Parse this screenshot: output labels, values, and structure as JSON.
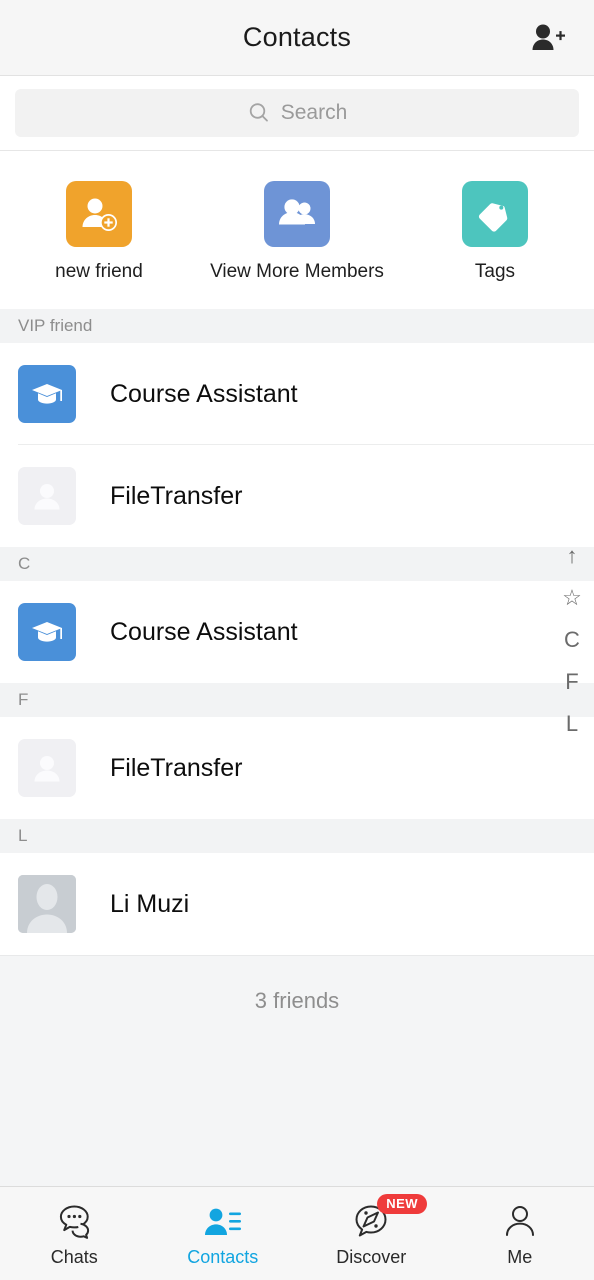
{
  "header": {
    "title": "Contacts",
    "add_friend_icon": "add-person-icon"
  },
  "search": {
    "placeholder": "Search",
    "icon": "search-icon"
  },
  "tiles": [
    {
      "label": "new friend",
      "icon": "person-add-icon",
      "color": "#f0a32c"
    },
    {
      "label": "View More Members",
      "icon": "group-icon",
      "color": "#6e94d6"
    },
    {
      "label": "Tags",
      "icon": "tag-icon",
      "color": "#4dc5be"
    }
  ],
  "sections": [
    {
      "header": "VIP friend",
      "contacts": [
        {
          "name": "Course Assistant",
          "avatar": "graduation-cap-icon",
          "avatar_type": "blue"
        },
        {
          "name": "FileTransfer",
          "avatar": "person-placeholder-icon",
          "avatar_type": "placeholder"
        }
      ]
    },
    {
      "header": "C",
      "contacts": [
        {
          "name": "Course Assistant",
          "avatar": "graduation-cap-icon",
          "avatar_type": "blue"
        }
      ]
    },
    {
      "header": "F",
      "contacts": [
        {
          "name": "FileTransfer",
          "avatar": "person-placeholder-icon",
          "avatar_type": "placeholder"
        }
      ]
    },
    {
      "header": "L",
      "contacts": [
        {
          "name": "Li Muzi",
          "avatar": "person-photo-icon",
          "avatar_type": "photo"
        }
      ]
    }
  ],
  "friend_count": "3 friends",
  "index_bar": [
    "↑",
    "☆",
    "C",
    "F",
    "L"
  ],
  "tabs": [
    {
      "label": "Chats",
      "icon": "chat-bubbles-icon",
      "active": false,
      "badge": ""
    },
    {
      "label": "Contacts",
      "icon": "contacts-icon",
      "active": true,
      "badge": ""
    },
    {
      "label": "Discover",
      "icon": "discover-compass-icon",
      "active": false,
      "badge": "NEW"
    },
    {
      "label": "Me",
      "icon": "person-outline-icon",
      "active": false,
      "badge": ""
    }
  ],
  "colors": {
    "active_tab": "#12a5e0",
    "badge": "#ef3b3b",
    "avatar_blue": "#4a90d9"
  }
}
